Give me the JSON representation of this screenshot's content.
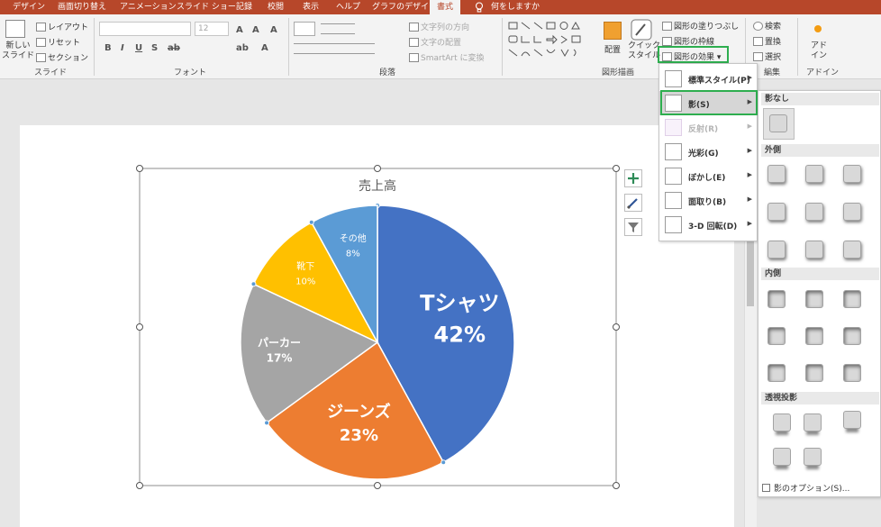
{
  "tabs": [
    "デザイン",
    "画面切り替え",
    "アニメーション",
    "スライド ショー",
    "記録",
    "校閲",
    "表示",
    "ヘルプ",
    "グラフのデザイン",
    "書式"
  ],
  "active_tab": "書式",
  "tell_me": "何をしますか",
  "ribbon": {
    "slide_group": {
      "new_slide": "新しい\nスライド",
      "layout": "レイアウト",
      "reset": "リセット",
      "section": "セクション",
      "label": "スライド"
    },
    "font_group": {
      "label": "フォント",
      "size": "12"
    },
    "para_group": {
      "label": "段落",
      "text_dir": "文字列の方向",
      "align_text": "文字の配置",
      "smartart": "SmartArt に変換"
    },
    "drawing_group": {
      "label": "図形描画",
      "arrange": "配置",
      "quick_style": "クイック\nスタイル",
      "fill": "図形の塗りつぶし",
      "outline": "図形の枠線",
      "effects": "図形の効果"
    },
    "editing_group": {
      "label": "編集",
      "find": "検索",
      "replace": "置換",
      "select": "選択"
    },
    "addin_group": {
      "label": "アドイン",
      "addin": "アド\nイン"
    }
  },
  "effects_menu": [
    {
      "label": "標準スタイル(P)",
      "state": "normal"
    },
    {
      "label": "影(S)",
      "state": "highlight"
    },
    {
      "label": "反射(R)",
      "state": "disabled"
    },
    {
      "label": "光彩(G)",
      "state": "normal"
    },
    {
      "label": "ぼかし(E)",
      "state": "normal"
    },
    {
      "label": "面取り(B)",
      "state": "normal"
    },
    {
      "label": "3-D 回転(D)",
      "state": "normal"
    }
  ],
  "shadow_gallery": {
    "none": "影なし",
    "outer": "外側",
    "inner": "内側",
    "perspective": "透視投影",
    "options": "影のオプション(S)..."
  },
  "chart_data": {
    "type": "pie",
    "title": "売上高",
    "slices": [
      {
        "label": "Tシャツ",
        "value": 42,
        "pct": "42%",
        "color": "#4472c4"
      },
      {
        "label": "ジーンズ",
        "value": 23,
        "pct": "23%",
        "color": "#ed7d31"
      },
      {
        "label": "パーカー",
        "value": 17,
        "pct": "17%",
        "color": "#a5a5a5"
      },
      {
        "label": "靴下",
        "value": 10,
        "pct": "10%",
        "color": "#ffc000"
      },
      {
        "label": "その他",
        "value": 8,
        "pct": "8%",
        "color": "#5b9bd5"
      }
    ]
  },
  "colors": {
    "accent": "#b7472a",
    "highlight_box": "#2eae4f"
  }
}
